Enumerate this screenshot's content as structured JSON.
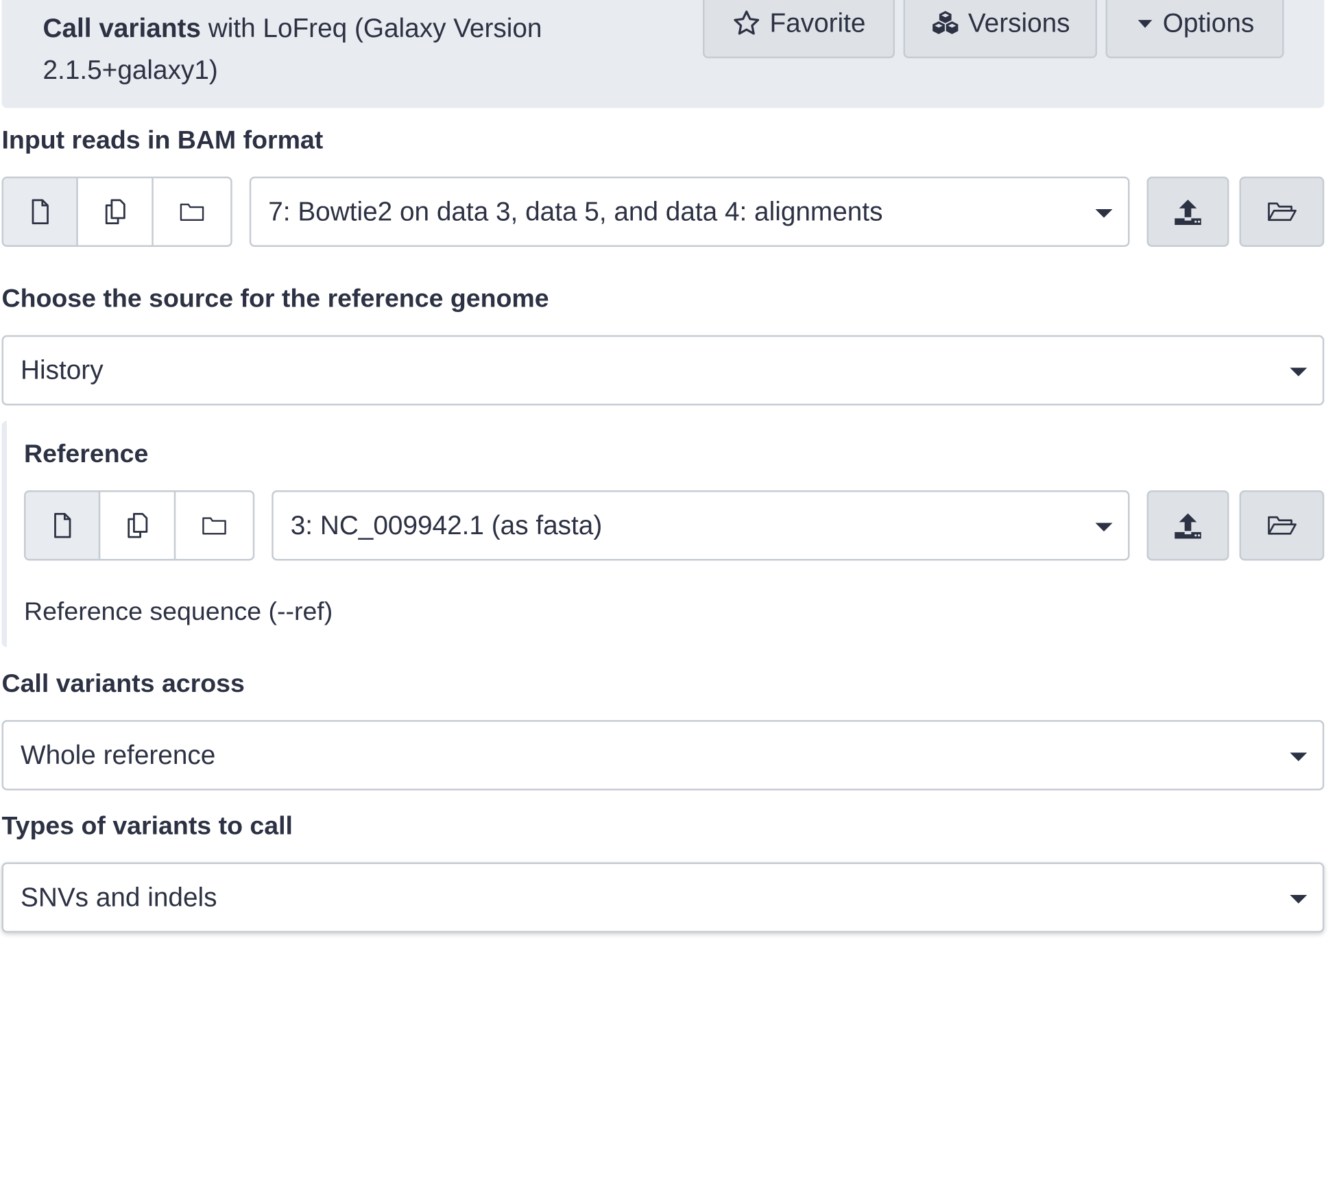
{
  "tool": {
    "title_bold": "Call variants",
    "title_rest": " with LoFreq (Galaxy Version 2.1.5+galaxy1)",
    "buttons": {
      "favorite": "Favorite",
      "versions": "Versions",
      "options": "Options"
    }
  },
  "fields": {
    "input_reads": {
      "label": "Input reads in BAM format",
      "value": "7: Bowtie2 on data 3, data 5, and data 4: alignments"
    },
    "ref_source": {
      "label": "Choose the source for the reference genome",
      "value": "History"
    },
    "reference": {
      "label": "Reference",
      "value": "3: NC_009942.1 (as fasta)",
      "help": "Reference sequence (--ref)"
    },
    "call_across": {
      "label": "Call variants across",
      "value": "Whole reference"
    },
    "variant_types": {
      "label": "Types of variants to call",
      "value": "SNVs and indels"
    }
  },
  "colors": {
    "header_bg": "#e8ebef",
    "button_bg": "#dee2e7",
    "border": "#c6ccd3",
    "text": "#2c3143"
  }
}
